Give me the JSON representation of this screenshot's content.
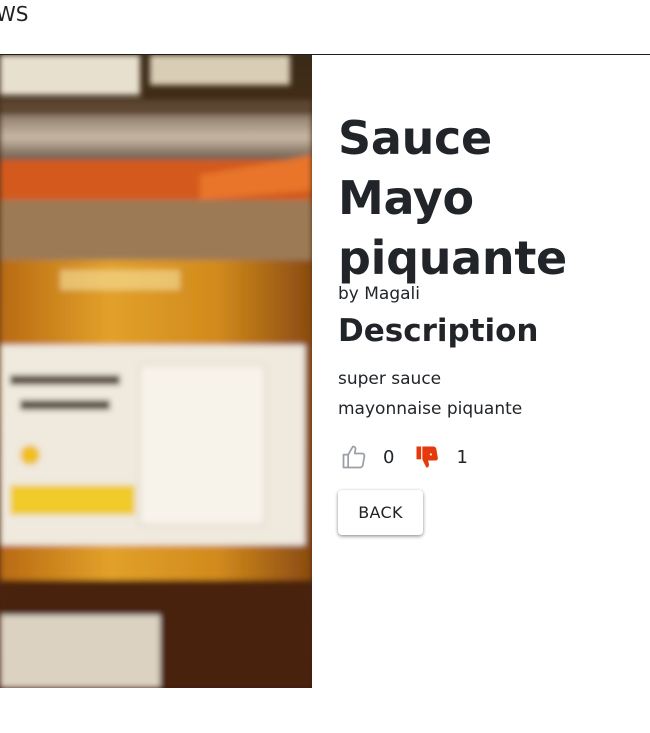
{
  "header": {
    "brand": "WS"
  },
  "recipe": {
    "title": "Sauce Mayo piquante",
    "author": "by Magali",
    "description_heading": "Description",
    "description": "super sauce mayonnaise piquante",
    "image_alt": "Jar of mayonnaise sauce"
  },
  "votes": {
    "likes": "0",
    "dislikes": "1",
    "like_icon": "thumbs-up-outline-icon",
    "dislike_icon": "thumbs-down-filled-icon",
    "like_color": "#9aa0a6",
    "dislike_color": "#e53a0e"
  },
  "actions": {
    "back_label": "BACK"
  }
}
